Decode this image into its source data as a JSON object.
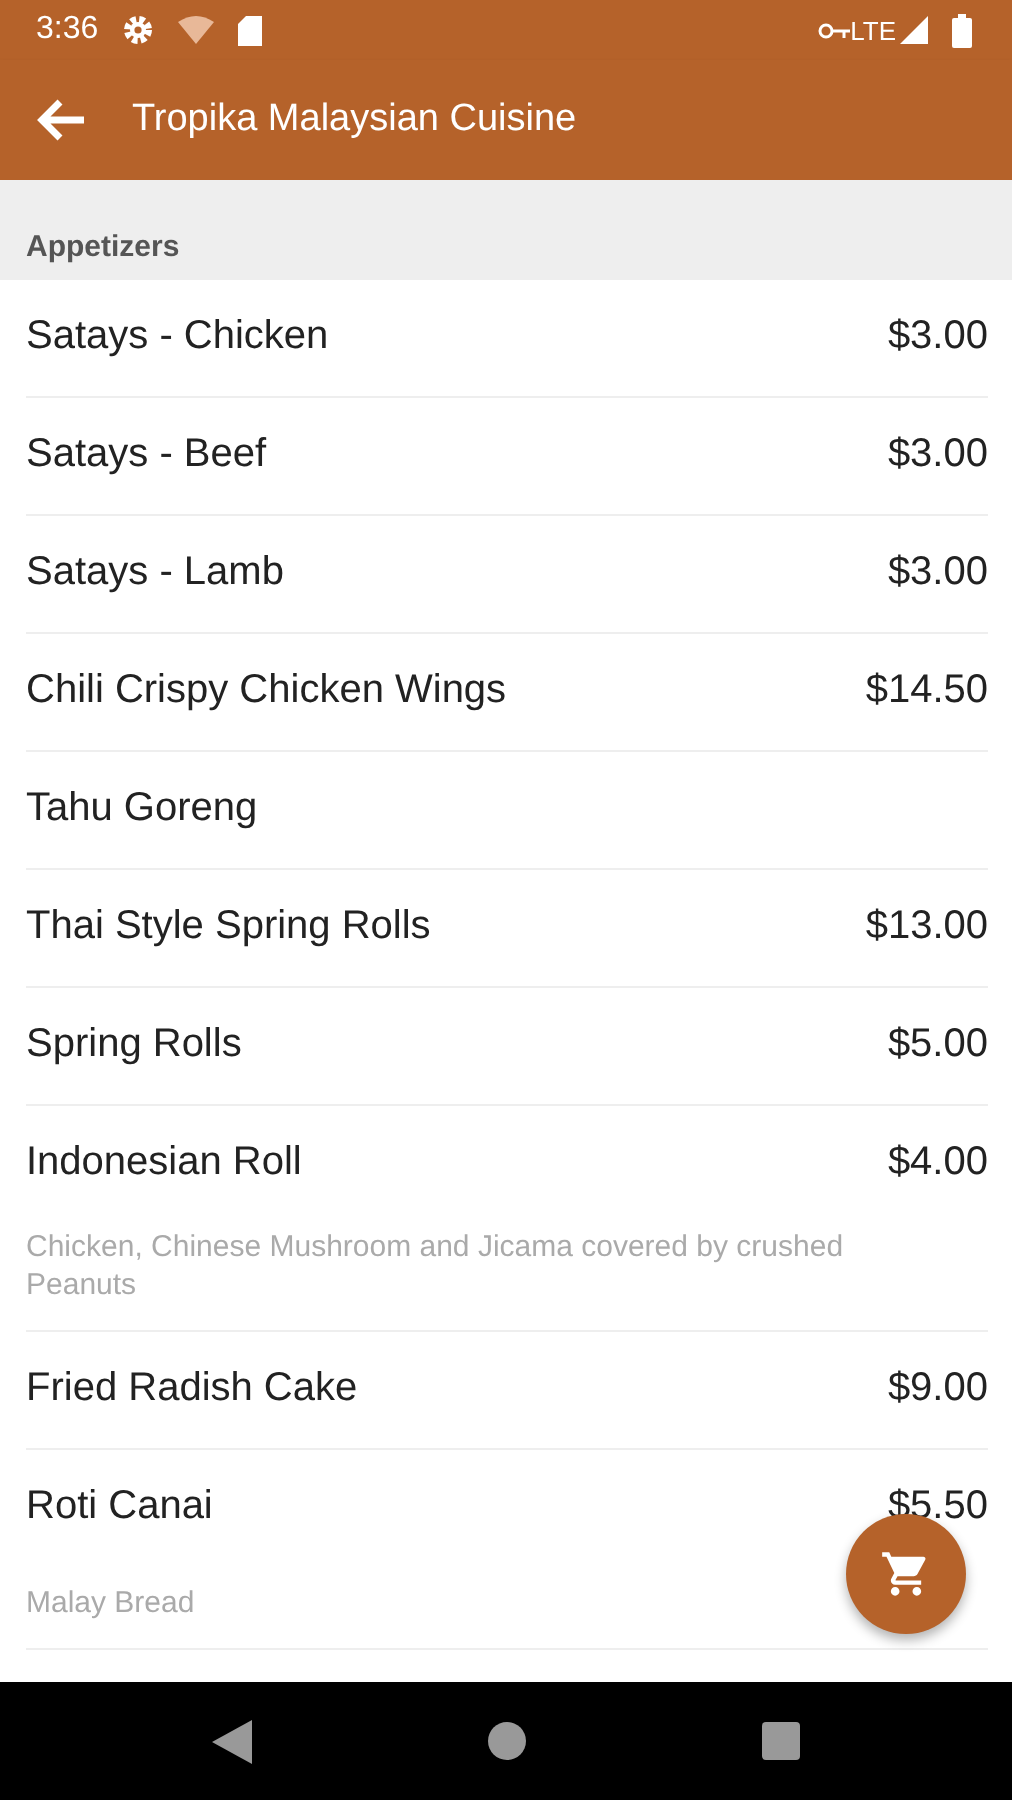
{
  "status_bar": {
    "time": "3:36",
    "network": "LTE"
  },
  "app_bar": {
    "title": "Tropika Malaysian Cuisine"
  },
  "section": {
    "title": "Appetizers"
  },
  "items": [
    {
      "name": "Satays - Chicken",
      "price": "$3.00"
    },
    {
      "name": "Satays - Beef",
      "price": "$3.00"
    },
    {
      "name": "Satays - Lamb",
      "price": "$3.00"
    },
    {
      "name": "Chili Crispy Chicken Wings",
      "price": "$14.50"
    },
    {
      "name": "Tahu Goreng"
    },
    {
      "name": "Thai Style Spring Rolls",
      "price": "$13.00"
    },
    {
      "name": "Spring Rolls",
      "price": "$5.00"
    },
    {
      "name": "Indonesian Roll",
      "price": "$4.00",
      "description": "Chicken, Chinese Mushroom and Jicama covered by crushed Peanuts"
    },
    {
      "name": "Fried Radish Cake",
      "price": "$9.00"
    },
    {
      "name": "Roti Canai",
      "price": "$5.50",
      "description": "Malay Bread"
    }
  ]
}
